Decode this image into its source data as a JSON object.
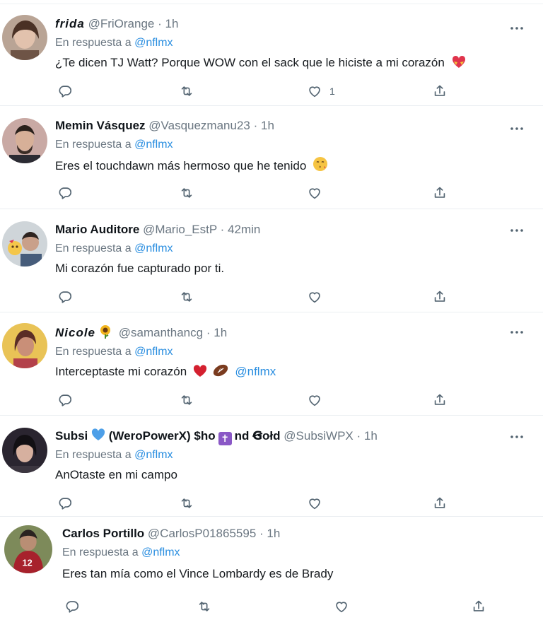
{
  "reply_prefix": "En respuesta a",
  "colors": {
    "link": "#2a8ee0",
    "muted": "#6b7782",
    "divider": "#eaeef1",
    "heart_blue": "#4d9fe8",
    "badge_purple": "#8a58c6"
  },
  "tweets": [
    {
      "name": "frida",
      "handle": "@FriOrange",
      "time": "1h",
      "reply_to": "@nflmx",
      "text": "¿Te dicen TJ Watt? Porque WOW con el sack que le hiciste a mi corazón",
      "likes": "1",
      "emoji": "heart-with-ribbon"
    },
    {
      "name": "Memin Vásquez",
      "handle": "@Vasquezmanu23",
      "time": "1h",
      "reply_to": "@nflmx",
      "text": "Eres el touchdawn más hermoso que he tenido",
      "emoji": "face-blowing-kiss"
    },
    {
      "name": "Mario Auditore",
      "handle": "@Mario_EstP",
      "time": "42min",
      "reply_to": "@nflmx",
      "text": "Mi corazón fue capturado por ti."
    },
    {
      "name": "Nicole",
      "handle": "@samanthancg",
      "time": "1h",
      "reply_to": "@nflmx",
      "text": "Interceptaste mi corazón",
      "text_mention": "@nflmx",
      "emoji": "heart-and-football"
    },
    {
      "name_part1": "Subsi",
      "name_part2": "(WeroPowerX) $ho",
      "name_part3": "nd Ꞡołd",
      "handle": "@SubsiWPX",
      "time": "1h",
      "reply_to": "@nflmx",
      "text": "AnOtaste en mi campo"
    },
    {
      "name": "Carlos Portillo",
      "handle": "@CarlosP01865595",
      "time": "1h",
      "reply_to": "@nflmx",
      "text": "Eres tan mía como el Vince Lombardy es de Brady"
    }
  ]
}
